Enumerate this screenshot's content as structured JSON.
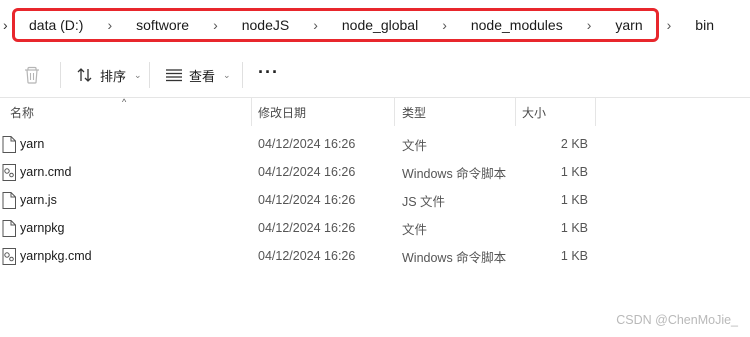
{
  "breadcrumb": {
    "items": [
      "data (D:)",
      "softwore",
      "nodeJS",
      "node_global",
      "node_modules",
      "yarn",
      "bin"
    ]
  },
  "toolbar": {
    "sort_label": "排序",
    "view_label": "查看",
    "more_label": "···"
  },
  "columns": {
    "name": "名称",
    "date": "修改日期",
    "type": "类型",
    "size": "大小"
  },
  "files": [
    {
      "name": "yarn",
      "date": "04/12/2024 16:26",
      "type": "文件",
      "size": "2 KB",
      "icon": "file-icon"
    },
    {
      "name": "yarn.cmd",
      "date": "04/12/2024 16:26",
      "type": "Windows 命令脚本",
      "size": "1 KB",
      "icon": "script-icon"
    },
    {
      "name": "yarn.js",
      "date": "04/12/2024 16:26",
      "type": "JS 文件",
      "size": "1 KB",
      "icon": "file-icon"
    },
    {
      "name": "yarnpkg",
      "date": "04/12/2024 16:26",
      "type": "文件",
      "size": "1 KB",
      "icon": "file-icon"
    },
    {
      "name": "yarnpkg.cmd",
      "date": "04/12/2024 16:26",
      "type": "Windows 命令脚本",
      "size": "1 KB",
      "icon": "script-icon"
    }
  ],
  "watermark": "CSDN @ChenMoJie_",
  "colors": {
    "highlight_border": "#e8262c"
  }
}
